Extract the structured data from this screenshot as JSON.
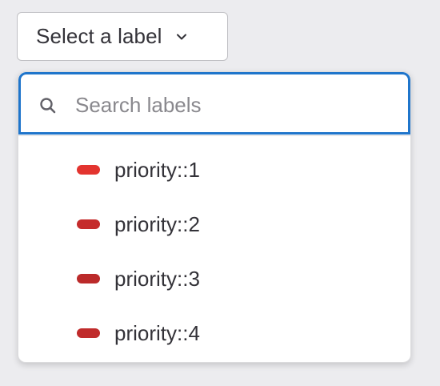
{
  "select": {
    "label": "Select a label",
    "chevron_icon": "chevron-down-icon"
  },
  "search": {
    "placeholder": "Search labels",
    "value": "",
    "icon": "search-icon",
    "focus_color": "#1f75cb"
  },
  "labels": [
    {
      "name": "priority::1",
      "color": "#e3342f"
    },
    {
      "name": "priority::2",
      "color": "#c52c2c"
    },
    {
      "name": "priority::3",
      "color": "#bb2a2a"
    },
    {
      "name": "priority::4",
      "color": "#c02b2b"
    }
  ]
}
